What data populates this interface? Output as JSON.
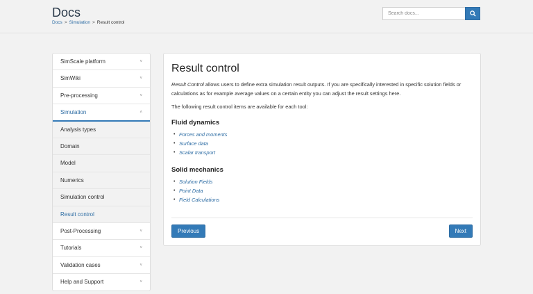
{
  "header": {
    "title": "Docs",
    "breadcrumb": [
      "Docs",
      "Simulation",
      "Result control"
    ],
    "breadcrumb_sep": ">",
    "search_placeholder": "Search docs...",
    "search_icon": "search-icon"
  },
  "sidebar": {
    "items": [
      {
        "label": "SimScale platform",
        "chevron": "˅"
      },
      {
        "label": "SimWiki",
        "chevron": "˅"
      },
      {
        "label": "Pre-processing",
        "chevron": "˅"
      },
      {
        "label": "Simulation",
        "chevron": "˄"
      }
    ],
    "sub_items": [
      {
        "label": "Analysis types"
      },
      {
        "label": "Domain"
      },
      {
        "label": "Model"
      },
      {
        "label": "Numerics"
      },
      {
        "label": "Simulation control"
      },
      {
        "label": "Result control"
      }
    ],
    "items_after": [
      {
        "label": "Post-Processing",
        "chevron": "˅"
      },
      {
        "label": "Tutorials",
        "chevron": "˅"
      },
      {
        "label": "Validation cases",
        "chevron": "˅"
      },
      {
        "label": "Help and Support",
        "chevron": "˅"
      }
    ]
  },
  "content": {
    "title": "Result control",
    "intro_term": "Result Control",
    "intro_rest": " allows users to define extra simulation result outputs. If you are specifically interested in specific solution fields or calculations as for example average values on a certain entity you can adjust the result settings here.",
    "intro2": "The following result control items are available for each tool:",
    "sections": [
      {
        "heading": "Fluid dynamics",
        "links": [
          "Forces and moments",
          "Surface data",
          "Scalar transport"
        ]
      },
      {
        "heading": "Solid mechanics",
        "links": [
          "Solution Fields",
          "Point Data",
          "Field Calculations"
        ]
      }
    ],
    "prev_label": "Previous",
    "next_label": "Next"
  },
  "colors": {
    "accent": "#337ab7",
    "link": "#2e6da4",
    "background": "#f2f2f2"
  }
}
